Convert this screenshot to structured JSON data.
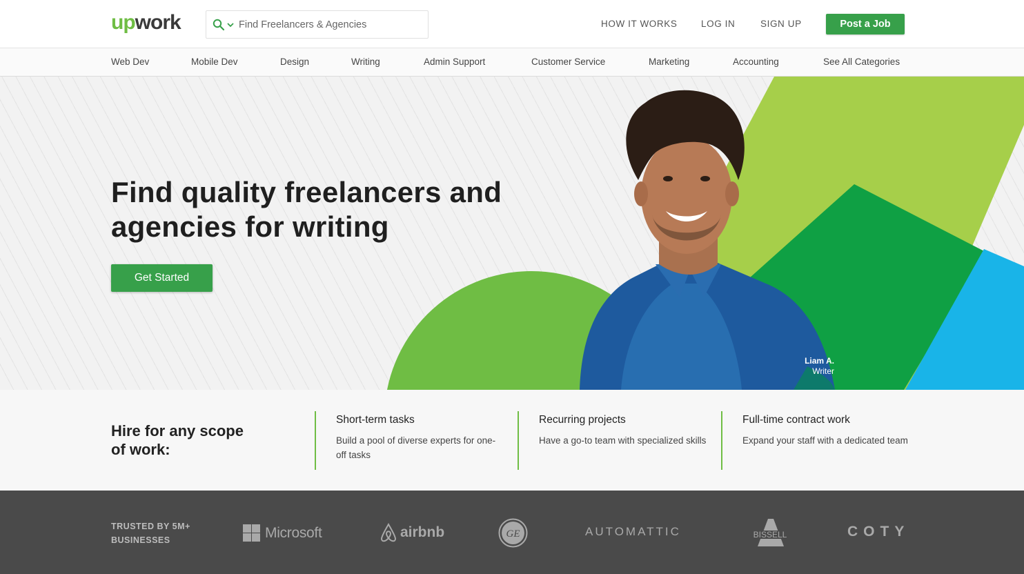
{
  "header": {
    "logo": {
      "part1": "up",
      "part2": "work"
    },
    "search": {
      "placeholder": "Find Freelancers & Agencies",
      "value": "",
      "icon": "search-icon",
      "dropdown_icon": "chevron-down-icon"
    },
    "nav": [
      {
        "label": "HOW IT WORKS"
      },
      {
        "label": "LOG IN"
      },
      {
        "label": "SIGN UP"
      }
    ],
    "cta_label": "Post a Job"
  },
  "categories": [
    {
      "label": "Web Dev"
    },
    {
      "label": "Mobile Dev"
    },
    {
      "label": "Design"
    },
    {
      "label": "Writing"
    },
    {
      "label": "Admin Support"
    },
    {
      "label": "Customer Service"
    },
    {
      "label": "Marketing"
    },
    {
      "label": "Accounting"
    },
    {
      "label": "See All Categories"
    }
  ],
  "hero": {
    "title_line1": "Find quality freelancers and",
    "title_line2": "agencies for writing",
    "button_label": "Get Started",
    "person_name": "Liam A.",
    "person_role": "Writer"
  },
  "scope": {
    "title_line1": "Hire for any scope",
    "title_line2": "of work:",
    "items": [
      {
        "title": "Short-term tasks",
        "description": "Build a pool of diverse experts for one-off tasks"
      },
      {
        "title": "Recurring projects",
        "description": "Have a go-to team with specialized skills"
      },
      {
        "title": "Full-time contract work",
        "description": "Expand your staff with a dedicated team"
      }
    ]
  },
  "trusted": {
    "label_line1": "TRUSTED BY 5M+",
    "label_line2": "BUSINESSES",
    "brands": [
      {
        "name": "Microsoft"
      },
      {
        "name": "airbnb"
      },
      {
        "name": "GE"
      },
      {
        "name": "AUTOMATTIC"
      },
      {
        "name": "BISSELL"
      },
      {
        "name": "COTY"
      }
    ]
  },
  "colors": {
    "brand_green": "#37a04a",
    "logo_green": "#6fbd44",
    "light_green": "#a6cf4a",
    "dark_green": "#0fa044",
    "blue": "#19b4e8",
    "footer_bg": "#4a4a4a"
  }
}
